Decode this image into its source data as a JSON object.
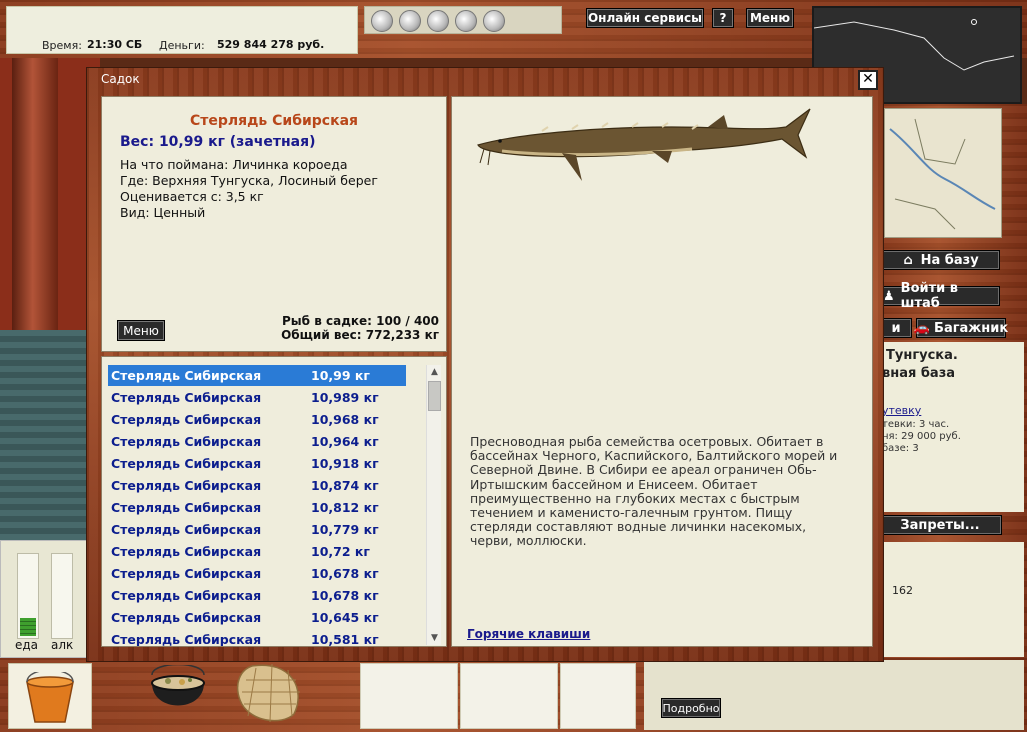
{
  "top": {
    "time_label": "Время:",
    "time_value": "21:30 СБ",
    "money_label": "Деньги:",
    "money_value": "529 844 278 руб.",
    "online_label": "Онлайн сервисы",
    "help_label": "?",
    "menu_label": "Меню"
  },
  "dialog": {
    "title": "Садок",
    "close_label": "✕",
    "fish": {
      "name": "Стерлядь Сибирская",
      "weight": "Вес: 10,99 кг (зачетная)",
      "bait": "На что поймана: Личинка короеда",
      "place": "Где: Верхняя Тунгуска, Лосиный берег",
      "rated": "Оценивается с: 3,5 кг",
      "kind": "Вид: Ценный"
    },
    "menu_label": "Меню",
    "count_text": "Рыб в садке: 100 / 400",
    "total_weight_text": "Общий вес: 772,233 кг",
    "catch_list": [
      {
        "name": "Стерлядь Сибирская",
        "weight": "10,99 кг",
        "selected": true
      },
      {
        "name": "Стерлядь Сибирская",
        "weight": "10,989 кг"
      },
      {
        "name": "Стерлядь Сибирская",
        "weight": "10,968 кг"
      },
      {
        "name": "Стерлядь Сибирская",
        "weight": "10,964 кг"
      },
      {
        "name": "Стерлядь Сибирская",
        "weight": "10,918 кг"
      },
      {
        "name": "Стерлядь Сибирская",
        "weight": "10,874 кг"
      },
      {
        "name": "Стерлядь Сибирская",
        "weight": "10,812 кг"
      },
      {
        "name": "Стерлядь Сибирская",
        "weight": "10,779 кг"
      },
      {
        "name": "Стерлядь Сибирская",
        "weight": "10,72 кг"
      },
      {
        "name": "Стерлядь Сибирская",
        "weight": "10,678 кг"
      },
      {
        "name": "Стерлядь Сибирская",
        "weight": "10,678 кг"
      },
      {
        "name": "Стерлядь Сибирская",
        "weight": "10,645 кг"
      },
      {
        "name": "Стерлядь Сибирская",
        "weight": "10,581 кг"
      }
    ],
    "description": "Пресноводная рыба семейства осетровых. Обитает в бассейнах Черного, Каспийского, Балтийского морей и Северной Двине. В Сибири ее ареал ограничен Обь-Иртышским бассейном и Енисеем. Обитает преимущественно на глубоких местах с быстрым течением и каменисто-галечным грунтом. Пищу стерляди составляют водные личинки насекомых, черви, моллюски.",
    "hotkeys_label": "Горячие клавиши"
  },
  "right": {
    "to_base": "На базу",
    "to_hq": "Войти в штаб",
    "trunk": "Багажник",
    "trunk_left_fragment": "и",
    "loc_line1": "Тунгуска.",
    "loc_line2": "вная база",
    "voucher_link": "утевку",
    "info1": "тевки: 3 час.",
    "info2": "ня: 29 000 руб.",
    "info3": "базе: 3",
    "bans": "Запреты...",
    "number": "162"
  },
  "meters": {
    "food_label": "еда",
    "alcohol_label": "алк",
    "food_level": 0.22,
    "alcohol_level": 0.0
  },
  "bottom": {
    "detail_label": "Подробно"
  },
  "colors": {
    "accent_blue": "#0c1e8e",
    "fish_name": "#b8471a",
    "selection": "#2a7bd6"
  }
}
